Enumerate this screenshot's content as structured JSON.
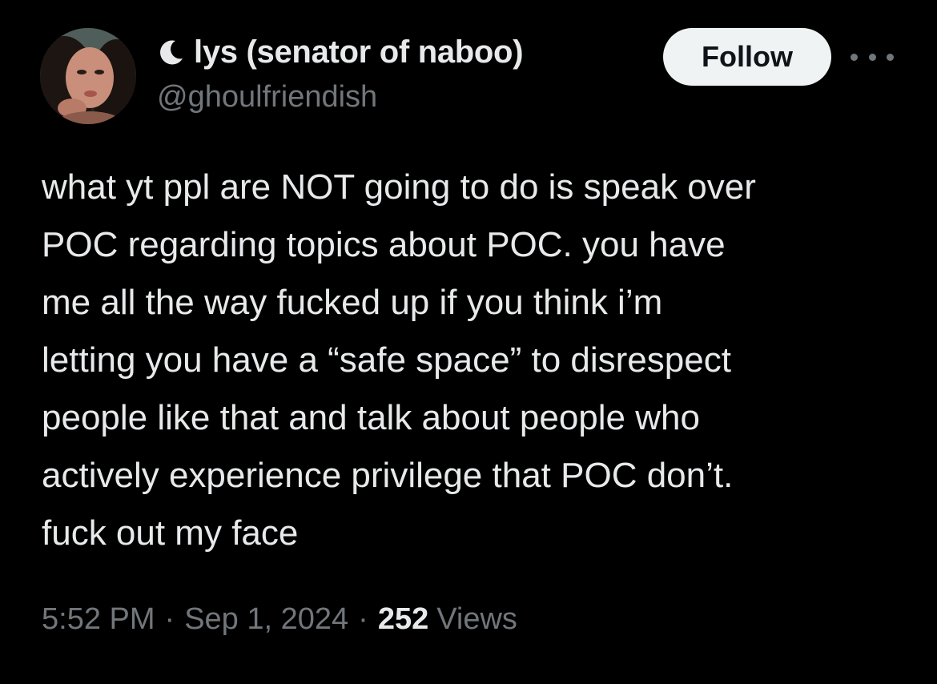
{
  "author": {
    "display_name": "lys (senator of naboo)",
    "handle": "@ghoulfriendish",
    "name_icon": "crescent-moon-icon",
    "avatar": "profile-photo"
  },
  "actions": {
    "follow_label": "Follow",
    "more_icon": "more-options-icon"
  },
  "tweet": {
    "lines": [
      "what yt ppl are NOT going to do is speak over",
      "POC regarding topics about POC. you have",
      "me all the way fucked up if you think i’m",
      "letting you have a “safe space” to disrespect",
      "people like that and talk about people who",
      "actively experience privilege that POC don’t.",
      "fuck out my face"
    ]
  },
  "meta": {
    "time": "5:52 PM",
    "separator": "·",
    "date": "Sep 1, 2024",
    "views_count": "252",
    "views_label": "Views"
  },
  "colors": {
    "background": "#000000",
    "primary_text": "#e7e9ea",
    "secondary_text": "#71767b",
    "follow_bg": "#eff3f4",
    "follow_text": "#0f1419"
  }
}
